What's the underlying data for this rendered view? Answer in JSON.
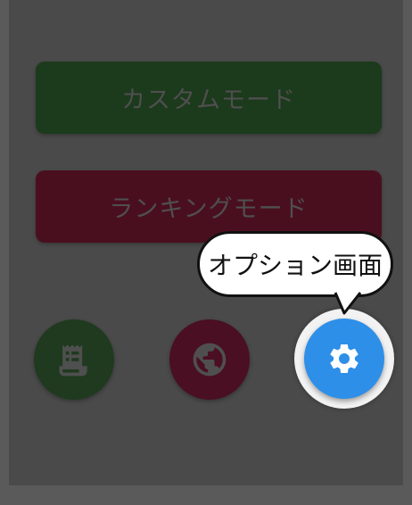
{
  "menu": {
    "custom_mode_label": "カスタムモード",
    "ranking_mode_label": "ランキングモード"
  },
  "icons": {
    "history": "receipt-icon",
    "online": "globe-icon",
    "options": "gear-icon"
  },
  "tooltip": {
    "text": "オプション画面"
  },
  "colors": {
    "backdrop": "#4a4a4a",
    "custom_mode": "#1c3a1c",
    "ranking_mode": "#4a0f1f",
    "options_fab": "#2e8fe8",
    "highlight": "#f2f2f2"
  }
}
